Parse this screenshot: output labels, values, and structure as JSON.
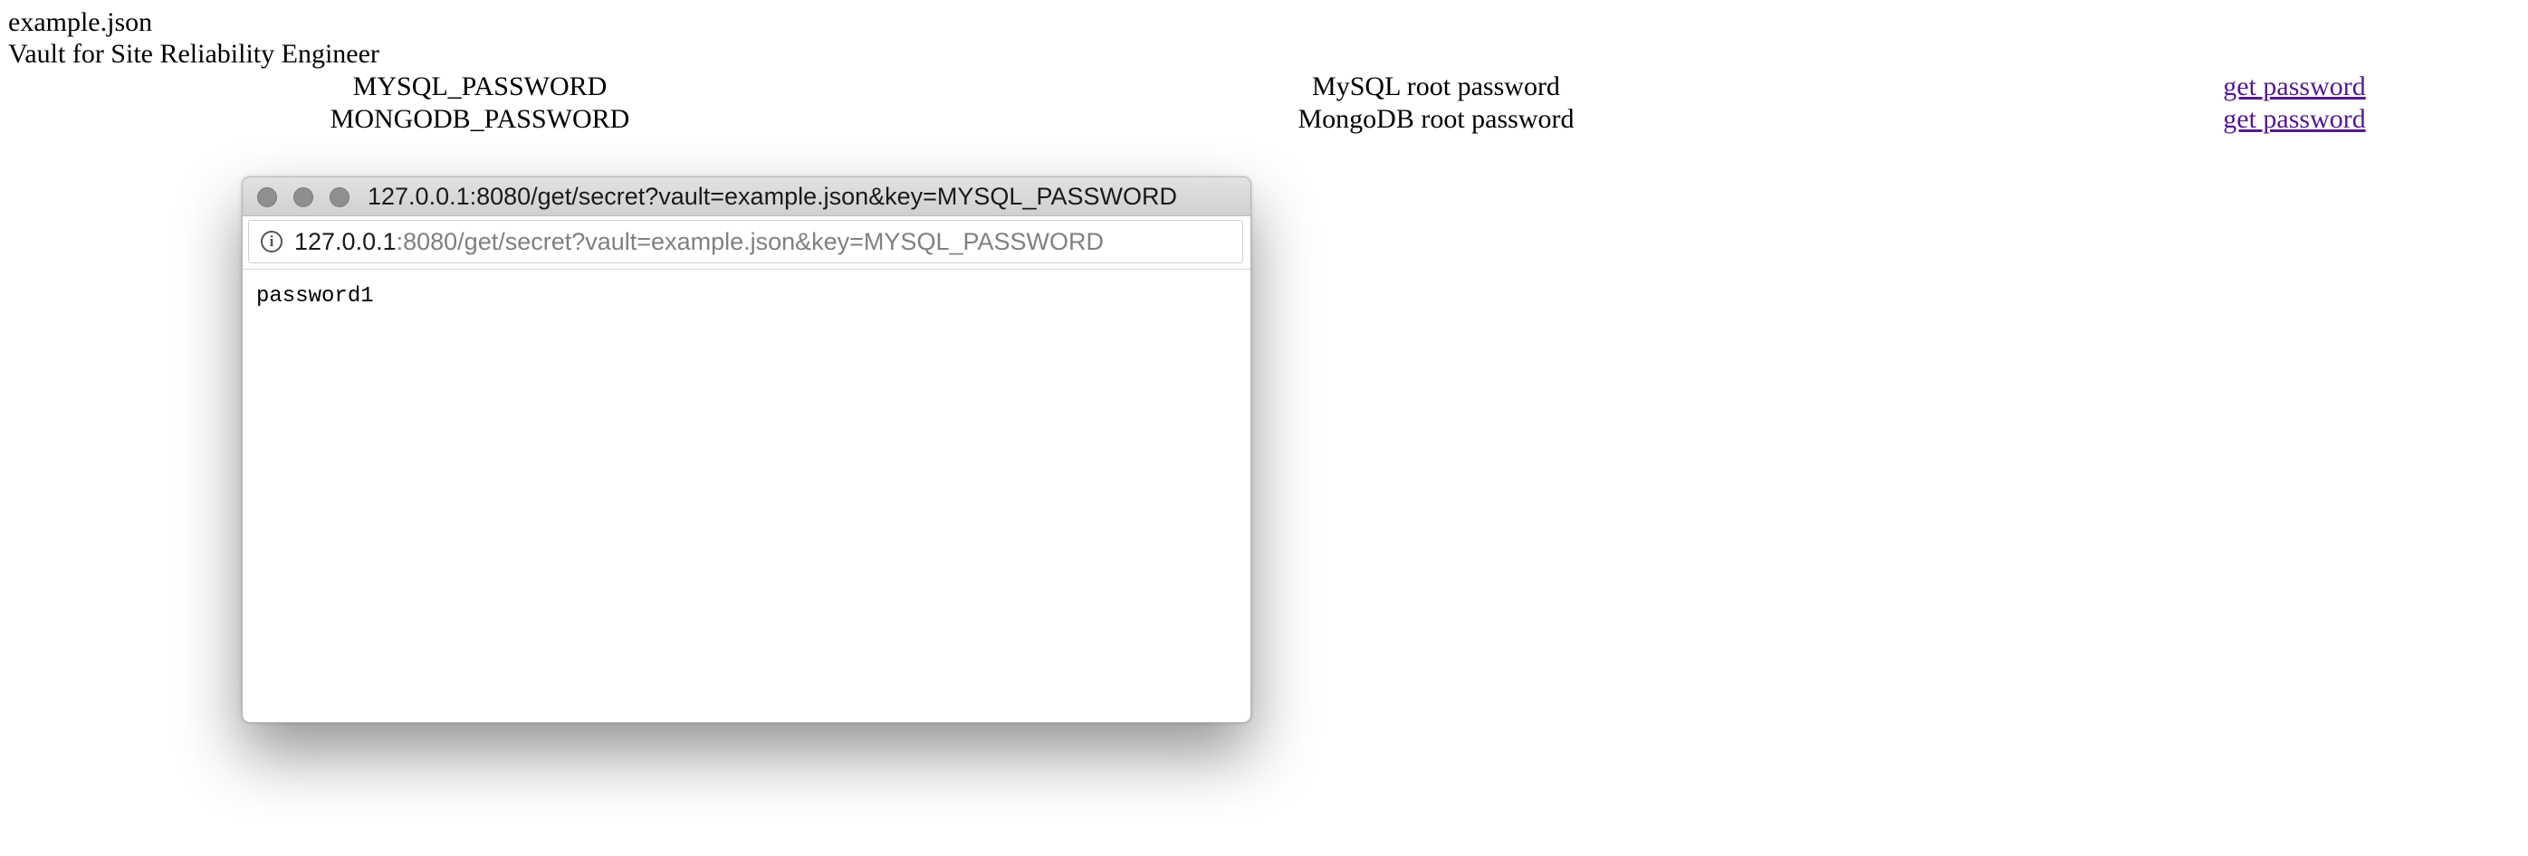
{
  "page": {
    "file_heading": "example.json",
    "vault_heading": "Vault for Site Reliability Engineer"
  },
  "secrets": [
    {
      "key": "MYSQL_PASSWORD",
      "description": "MySQL root password",
      "action": "get password"
    },
    {
      "key": "MONGODB_PASSWORD",
      "description": "MongoDB root password",
      "action": "get password"
    }
  ],
  "popup": {
    "title": "127.0.0.1:8080/get/secret?vault=example.json&key=MYSQL_PASSWORD",
    "url_host": "127.0.0.1",
    "url_rest": ":8080/get/secret?vault=example.json&key=MYSQL_PASSWORD",
    "info_icon": "info-icon",
    "info_glyph": "i",
    "content": "password1"
  },
  "colors": {
    "link": "#551a8b",
    "traffic_light": "#8f8f8f"
  }
}
